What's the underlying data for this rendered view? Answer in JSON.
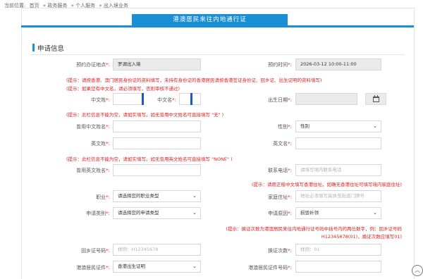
{
  "breadcrumb": {
    "prefix": "当前位置:",
    "items": [
      "首页",
      "» 政务服务",
      "» 个人服务",
      "» 出入境业务"
    ]
  },
  "header": {
    "title": "港澳居民来往内地通行证"
  },
  "section": {
    "title": "申请信息"
  },
  "fields": {
    "appointment_place": {
      "label": "预约办证地点",
      "value": "罗湖出入境"
    },
    "appointment_time": {
      "label": "预约时间",
      "value": "2026-03-12 10:00-11:00"
    },
    "cn_surname": {
      "label": "中文姓",
      "value": ""
    },
    "cn_name": {
      "label": "中文名",
      "value": ""
    },
    "birth_date": {
      "label": "出生日期",
      "value": ""
    },
    "common_cn_name": {
      "label": "曾用中文姓名",
      "value": ""
    },
    "gender": {
      "label": "性别",
      "value": "性别"
    },
    "en_surname": {
      "label": "英文姓",
      "value": ""
    },
    "en_name": {
      "label": "英文名",
      "value": ""
    },
    "common_en_name": {
      "label": "曾用英文姓名",
      "value": ""
    },
    "phone": {
      "label": "联系电话",
      "placeholder": "请填写境内联系电话"
    },
    "occupation": {
      "label": "职业",
      "value": "请选择您的职业类型"
    },
    "home_address": {
      "label": "家庭住址",
      "placeholder": "地址必须填写具体至街道门牌号"
    },
    "apply_type": {
      "label": "申请类别",
      "value": "请选择您的申请类型"
    },
    "apply_reason": {
      "label": "申请原因",
      "value": "损毁补领"
    },
    "return_permit_no": {
      "label": "回乡证号码",
      "placeholder": "样例：H12345678"
    },
    "renewal_count": {
      "label": "换证次数",
      "placeholder": "样例：01"
    },
    "hk_id_type": {
      "label": "港澳居民证件",
      "value": "香港出生证明"
    },
    "hk_id_no": {
      "label": "港澳居民证件号码",
      "value": ""
    }
  },
  "required_mark": "*:",
  "hints": {
    "id_note_1": "(提示：请按香港、澳门居民身份证的资料填写，未持有身份证的香港居民请按香港签证身份证、回乡证、出生证明的资料填写)",
    "id_note_2": "(提示：如果您有中文名，请必须填写，否则审核不通过)",
    "cn_name_note": "(提示：此栏信息不能为空，请如实填写。如无曾用中文姓名可直接填写 \"无\" )",
    "en_name_note": "(提示：此栏信息不能为空，请如实填写。如无曾用英文姓名可直接填写 \"NONE\" )",
    "address_note": "(提示：请用正楷中文填写香港住址，如确无香港住址可填写境内家庭住址)",
    "renewal_note_1": "(提示：换证次数为港澳居民来往内地通行证号码中括号内的两位数字，例：回乡证号码",
    "renewal_note_2": "H12345678(01)，换证次数应填写01)"
  },
  "icons": {
    "calendar": "calendar-icon",
    "scroll_top": "chevron-up-icon",
    "select_caret": "chevron-down-icon"
  },
  "colors": {
    "accent": "#1a8fd6",
    "required": "#e02020",
    "readonly_bg": "#ebebeb"
  }
}
